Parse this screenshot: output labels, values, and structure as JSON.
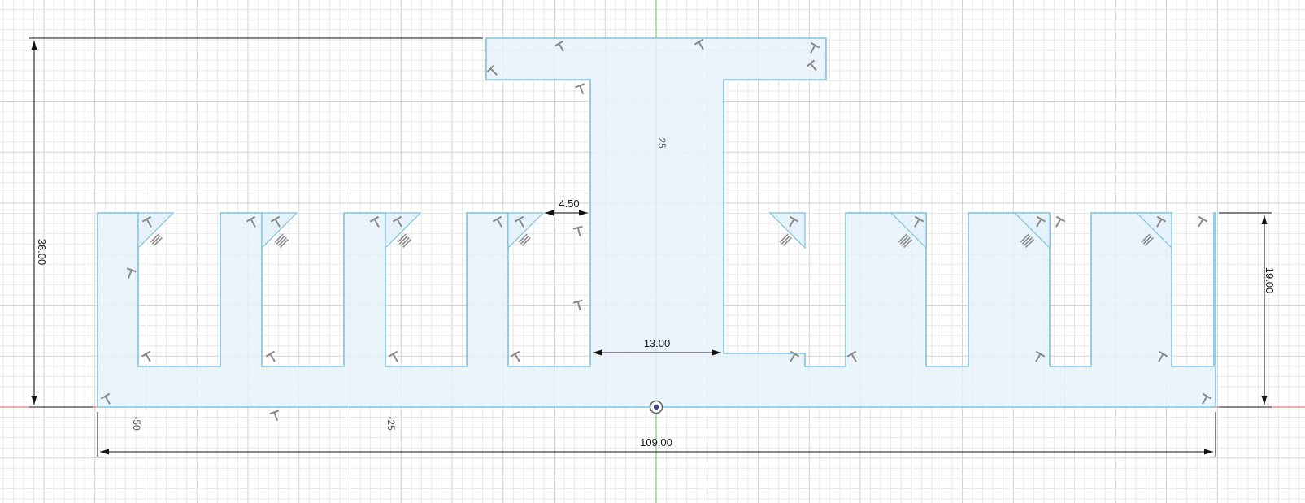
{
  "colors": {
    "background": "#ffffff",
    "grid_minor": "#e8e8e8",
    "grid_major": "#d2d2d2",
    "profile_fill": "#e6f2f9",
    "profile_stroke": "#7ec3dc",
    "axis_y": "#5cc05c",
    "axis_x": "#e06060",
    "dimension": "#111111",
    "constraint_glyph": "#8a8a8a"
  },
  "dimensions": {
    "overall_height": "36.00",
    "right_height": "19.00",
    "overall_width": "109.00",
    "stem_width": "13.00",
    "slot_gap": "4.50"
  },
  "ruler_labels": {
    "vertical_25": "25",
    "horizontal_neg50": "-50",
    "horizontal_neg25": "-25"
  },
  "icons": {
    "origin": "origin-point-icon",
    "constraint": "perpendicular-constraint-icon",
    "parallel": "parallel-constraint-icon"
  }
}
